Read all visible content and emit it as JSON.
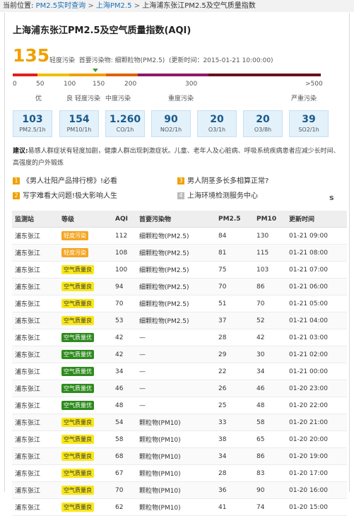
{
  "breadcrumb": {
    "prefix": "当前位置:",
    "items": [
      "PM2.5实时查询",
      "上海PM2.5",
      "上海浦东张江PM2.5及空气质量指数"
    ],
    "sep": ">"
  },
  "page_title": "上海浦东张江PM2.5及空气质量指数(AQI)",
  "current": {
    "aqi": "135",
    "level": "轻度污染",
    "pollutant_label": "首要污染物:",
    "pollutant": "细颗粒物(PM2.5)",
    "update_label": "(更新时间：",
    "update_time": "2015-01-21 10:00:00)"
  },
  "scale": {
    "colors": [
      "#e02020",
      "#f0c000",
      "#f0a000",
      "#e06000",
      "#8a1a6a",
      "#6a1020"
    ],
    "ticks": [
      "0",
      "50",
      "100",
      "150",
      "200",
      "300",
      ">500"
    ],
    "levels": [
      "优",
      "良",
      "轻度污染",
      "中度污染",
      "重度污染",
      "严重污染"
    ]
  },
  "pollutants": [
    {
      "value": "103",
      "label": "PM2.5/1h"
    },
    {
      "value": "154",
      "label": "PM10/1h"
    },
    {
      "value": "1.260",
      "label": "CO/1h"
    },
    {
      "value": "90",
      "label": "NO2/1h"
    },
    {
      "value": "20",
      "label": "O3/1h"
    },
    {
      "value": "20",
      "label": "O3/8h"
    },
    {
      "value": "39",
      "label": "SO2/1h"
    }
  ],
  "advice": {
    "label": "建议:",
    "text": "易感人群症状有轻度加剧，健康人群出现刺激症状。儿童、老年人及心脏病、呼吸系统疾病患者应减少长时间、高强度的户外锻炼"
  },
  "links": [
    {
      "num": "1",
      "num_color": "#f0a000",
      "text": "《男人壮阳产品排行榜》!必看"
    },
    {
      "num": "2",
      "num_color": "#f0a000",
      "text": "写字难看大问题!极大影响人生"
    },
    {
      "num": "3",
      "num_color": "#f0a000",
      "text": "男人阴茎多长多相算正常?"
    },
    {
      "num": "4",
      "num_color": "#bbbbbb",
      "text": "上海环境检测服务中心"
    }
  ],
  "links_mark": "s",
  "table": {
    "headers": [
      "监测站",
      "等级",
      "AQI",
      "首要污染物",
      "PM2.5",
      "PM10",
      "更新时间"
    ],
    "rows": [
      {
        "station": "浦东张江",
        "level": "轻度污染",
        "level_bg": "#f5a623",
        "level_fg": "#ffffff",
        "aqi": "112",
        "pollutant": "细颗粒物(PM2.5)",
        "pm25": "84",
        "pm10": "130",
        "time": "01-21 09:00"
      },
      {
        "station": "浦东张江",
        "level": "轻度污染",
        "level_bg": "#f5a623",
        "level_fg": "#ffffff",
        "aqi": "108",
        "pollutant": "细颗粒物(PM2.5)",
        "pm25": "81",
        "pm10": "115",
        "time": "01-21 08:00"
      },
      {
        "station": "浦东张江",
        "level": "空气质量良",
        "level_bg": "#f8e71c",
        "level_fg": "#333333",
        "aqi": "100",
        "pollutant": "细颗粒物(PM2.5)",
        "pm25": "75",
        "pm10": "103",
        "time": "01-21 07:00"
      },
      {
        "station": "浦东张江",
        "level": "空气质量良",
        "level_bg": "#f8e71c",
        "level_fg": "#333333",
        "aqi": "94",
        "pollutant": "细颗粒物(PM2.5)",
        "pm25": "70",
        "pm10": "86",
        "time": "01-21 06:00"
      },
      {
        "station": "浦东张江",
        "level": "空气质量良",
        "level_bg": "#f8e71c",
        "level_fg": "#333333",
        "aqi": "70",
        "pollutant": "细颗粒物(PM2.5)",
        "pm25": "51",
        "pm10": "70",
        "time": "01-21 05:00"
      },
      {
        "station": "浦东张江",
        "level": "空气质量良",
        "level_bg": "#f8e71c",
        "level_fg": "#333333",
        "aqi": "53",
        "pollutant": "细颗粒物(PM2.5)",
        "pm25": "37",
        "pm10": "52",
        "time": "01-21 04:00"
      },
      {
        "station": "浦东张江",
        "level": "空气质量优",
        "level_bg": "#2e8b1e",
        "level_fg": "#ffffff",
        "aqi": "42",
        "pollutant": "—",
        "pm25": "28",
        "pm10": "42",
        "time": "01-21 03:00"
      },
      {
        "station": "浦东张江",
        "level": "空气质量优",
        "level_bg": "#2e8b1e",
        "level_fg": "#ffffff",
        "aqi": "42",
        "pollutant": "—",
        "pm25": "29",
        "pm10": "30",
        "time": "01-21 02:00"
      },
      {
        "station": "浦东张江",
        "level": "空气质量优",
        "level_bg": "#2e8b1e",
        "level_fg": "#ffffff",
        "aqi": "34",
        "pollutant": "—",
        "pm25": "22",
        "pm10": "34",
        "time": "01-21 00:00"
      },
      {
        "station": "浦东张江",
        "level": "空气质量优",
        "level_bg": "#2e8b1e",
        "level_fg": "#ffffff",
        "aqi": "46",
        "pollutant": "—",
        "pm25": "26",
        "pm10": "46",
        "time": "01-20 23:00"
      },
      {
        "station": "浦东张江",
        "level": "空气质量优",
        "level_bg": "#2e8b1e",
        "level_fg": "#ffffff",
        "aqi": "48",
        "pollutant": "—",
        "pm25": "25",
        "pm10": "48",
        "time": "01-20 22:00"
      },
      {
        "station": "浦东张江",
        "level": "空气质量良",
        "level_bg": "#f8e71c",
        "level_fg": "#333333",
        "aqi": "54",
        "pollutant": "颗粒物(PM10)",
        "pm25": "33",
        "pm10": "58",
        "time": "01-20 21:00"
      },
      {
        "station": "浦东张江",
        "level": "空气质量良",
        "level_bg": "#f8e71c",
        "level_fg": "#333333",
        "aqi": "58",
        "pollutant": "颗粒物(PM10)",
        "pm25": "38",
        "pm10": "65",
        "time": "01-20 20:00"
      },
      {
        "station": "浦东张江",
        "level": "空气质量良",
        "level_bg": "#f8e71c",
        "level_fg": "#333333",
        "aqi": "68",
        "pollutant": "颗粒物(PM10)",
        "pm25": "34",
        "pm10": "86",
        "time": "01-20 19:00"
      },
      {
        "station": "浦东张江",
        "level": "空气质量良",
        "level_bg": "#f8e71c",
        "level_fg": "#333333",
        "aqi": "67",
        "pollutant": "颗粒物(PM10)",
        "pm25": "28",
        "pm10": "83",
        "time": "01-20 17:00"
      },
      {
        "station": "浦东张江",
        "level": "空气质量良",
        "level_bg": "#f8e71c",
        "level_fg": "#333333",
        "aqi": "70",
        "pollutant": "颗粒物(PM10)",
        "pm25": "36",
        "pm10": "90",
        "time": "01-20 16:00"
      },
      {
        "station": "浦东张江",
        "level": "空气质量良",
        "level_bg": "#f8e71c",
        "level_fg": "#333333",
        "aqi": "62",
        "pollutant": "颗粒物(PM10)",
        "pm25": "41",
        "pm10": "74",
        "time": "01-20 15:00"
      }
    ]
  }
}
